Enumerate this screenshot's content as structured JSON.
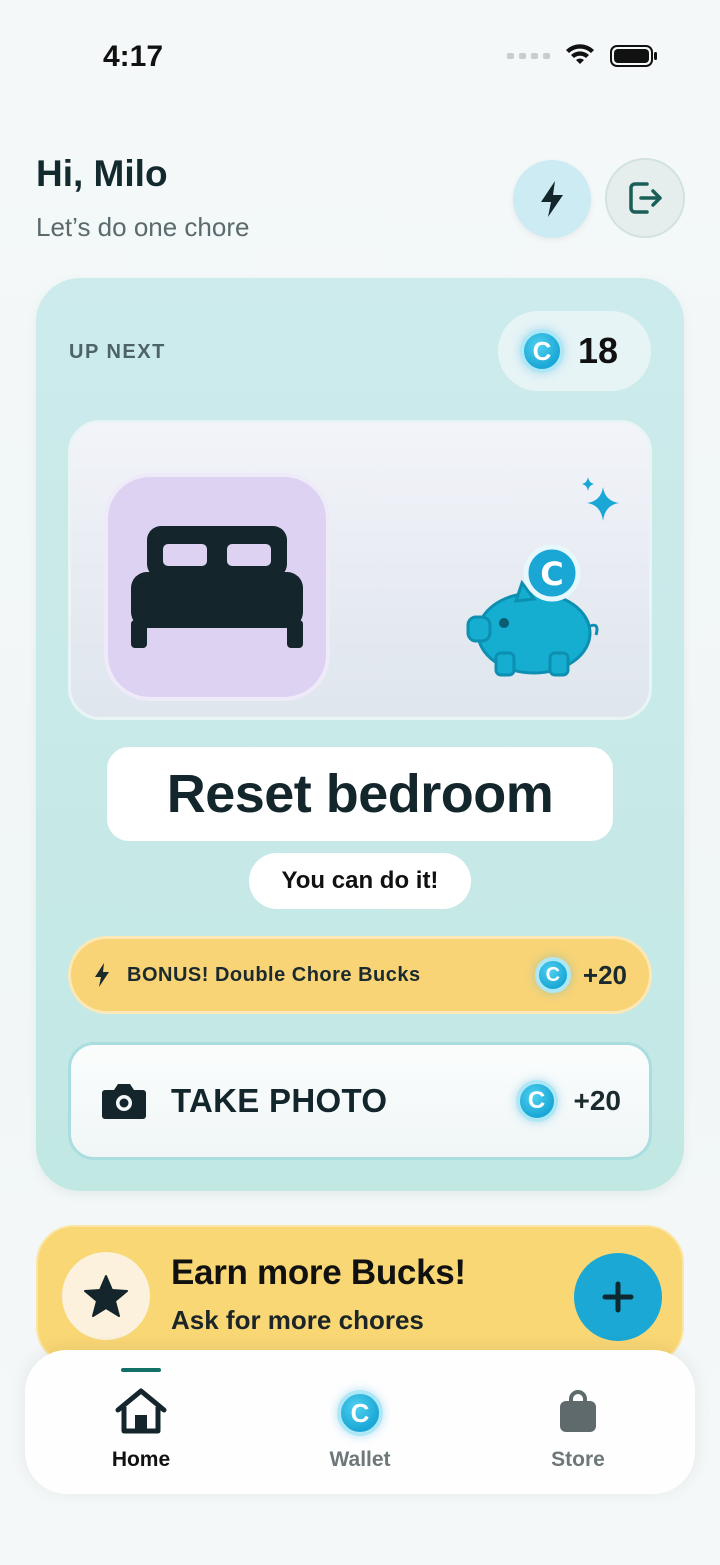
{
  "status_bar": {
    "time": "4:17"
  },
  "header": {
    "greeting": "Hi, Milo",
    "subtitle": "Let’s do one chore",
    "icons": [
      "bolt-icon",
      "logout-icon"
    ]
  },
  "card": {
    "up_next_label": "UP NEXT",
    "coin_balance": "18",
    "chore_icon": "bed-icon",
    "reward_icon": "piggy-bank-icon",
    "chore_title": "Reset bedroom",
    "encouragement": "You can do it!",
    "bonus": {
      "label": "BONUS!  Double Chore Bucks",
      "amount": "+20"
    },
    "take_photo": {
      "label": "TAKE PHOTO",
      "amount": "+20"
    }
  },
  "earn_more": {
    "title": "Earn more Bucks!",
    "subtitle": "Ask for more chores"
  },
  "tabs": [
    {
      "label": "Home",
      "icon": "home-icon",
      "active": true
    },
    {
      "label": "Wallet",
      "icon": "coin-icon",
      "active": false
    },
    {
      "label": "Store",
      "icon": "bag-icon",
      "active": false
    }
  ],
  "colors": {
    "card_bg": "#c8eae8",
    "accent_yellow": "#f8d477",
    "coin_blue": "#1aa7d6",
    "active_tab": "#137066"
  }
}
